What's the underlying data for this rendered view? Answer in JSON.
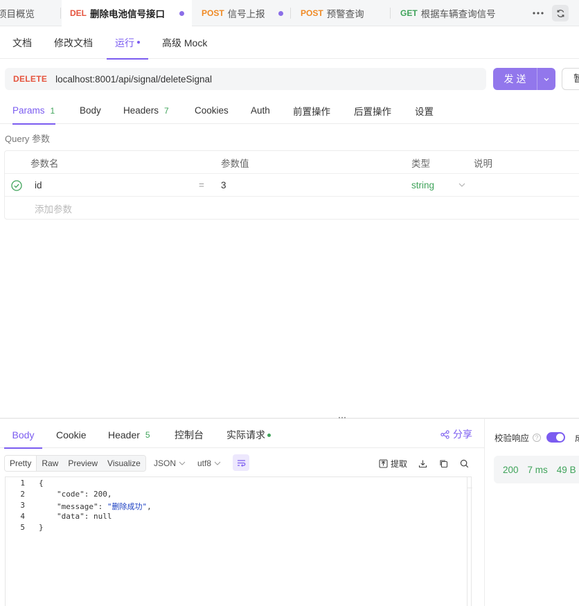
{
  "top_tabs": [
    {
      "method": "",
      "label": "项目概览"
    },
    {
      "method": "DEL",
      "label": "删除电池信号接口",
      "method_color": "#e5533d"
    },
    {
      "method": "POST",
      "label": "信号上报",
      "method_color": "#f08a24"
    },
    {
      "method": "POST",
      "label": "预警查询",
      "method_color": "#f08a24"
    },
    {
      "method": "GET",
      "label": "根据车辆查询信号",
      "method_color": "#3fa35a"
    }
  ],
  "sub_tabs": [
    "文档",
    "修改文档",
    "运行",
    "高级 Mock"
  ],
  "request": {
    "method": "DELETE",
    "url": "localhost:8001/api/signal/deleteSignal",
    "send_label": "发送",
    "save_label": "暂存"
  },
  "request_tabs": [
    {
      "label": "Params",
      "count": "1"
    },
    {
      "label": "Body",
      "count": ""
    },
    {
      "label": "Headers",
      "count": "7"
    },
    {
      "label": "Cookies",
      "count": ""
    },
    {
      "label": "Auth",
      "count": ""
    },
    {
      "label": "前置操作",
      "count": ""
    },
    {
      "label": "后置操作",
      "count": ""
    },
    {
      "label": "设置",
      "count": ""
    }
  ],
  "query_label": "Query 参数",
  "params_table": {
    "headers": [
      "参数名",
      "参数值",
      "类型",
      "说明"
    ],
    "rows": [
      {
        "name": "id",
        "eq": "=",
        "value": "3",
        "type": "string"
      }
    ],
    "add_placeholder": "添加参数"
  },
  "response_tabs": [
    {
      "label": "Body",
      "count": ""
    },
    {
      "label": "Cookie",
      "count": ""
    },
    {
      "label": "Header",
      "count": "5"
    },
    {
      "label": "控制台",
      "count": ""
    },
    {
      "label": "实际请求",
      "count": ""
    }
  ],
  "share_label": "分享",
  "verify_label": "校验响应",
  "verify_more": "成",
  "status": {
    "code": "200",
    "time": "7 ms",
    "size": "49 B"
  },
  "format_buttons": [
    "Pretty",
    "Raw",
    "Preview",
    "Visualize"
  ],
  "format_select": "JSON",
  "encoding_select": "utf8",
  "extract_label": "提取",
  "code_lines": {
    "l1": "{",
    "l2_key": "\"code\"",
    "l2_val": "200",
    "l3_key": "\"message\"",
    "l3_val": "\"删除成功\"",
    "l4_key": "\"data\"",
    "l4_val": "null",
    "l5": "}"
  },
  "line_numbers": [
    "1",
    "2",
    "3",
    "4",
    "5"
  ],
  "colors": {
    "accent": "#7b5cf0",
    "send": "#9277ec",
    "success": "#3fa35a",
    "delete": "#e5533d",
    "post": "#f08a24"
  }
}
